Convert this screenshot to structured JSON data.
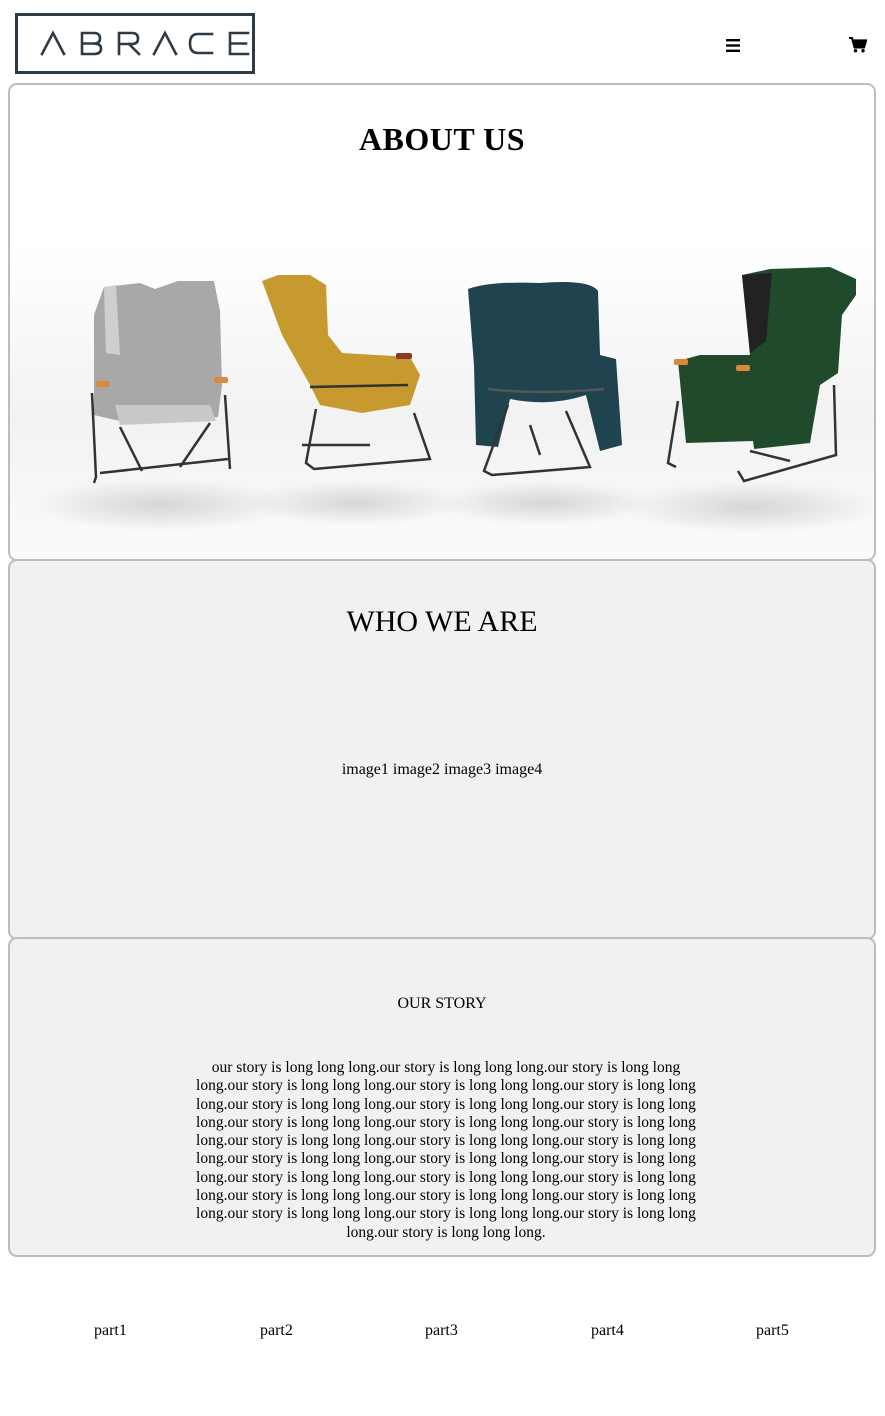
{
  "brand": {
    "logo_text": "ABRACE",
    "logo_color": "#2f3b44"
  },
  "header": {
    "menu_icon": "hamburger-icon",
    "cart_icon": "shopping-cart-icon"
  },
  "about": {
    "title": "ABOUT US",
    "chairs": [
      {
        "name": "grey chair",
        "color": "#9a9a9a"
      },
      {
        "name": "mustard chair",
        "color": "#c69a2e"
      },
      {
        "name": "teal chair",
        "color": "#1f4450"
      },
      {
        "name": "green chair",
        "color": "#1f4a2c"
      }
    ]
  },
  "who_we_are": {
    "title": "WHO WE ARE",
    "images_text": "image1 image2 image3 image4"
  },
  "our_story": {
    "title": "OUR STORY",
    "body": "our story is long long long.our story is long long long.our story is long long long.our story is long long long.our story is long long long.our story is long long long.our story is long long long.our story is long long long.our story is long long long.our story is long long long.our story is long long long.our story is long long long.our story is long long long.our story is long long long.our story is long long long.our story is long long long.our story is long long long.our story is long long long.our story is long long long.our story is long long long.our story is long long long.our story is long long long.our story is long long long.our story is long long long.our story is long long long.our story is long long long.our story is long long long.our story is long long long."
  },
  "footer": {
    "parts": [
      "part1",
      "part2",
      "part3",
      "part4",
      "part5"
    ]
  }
}
